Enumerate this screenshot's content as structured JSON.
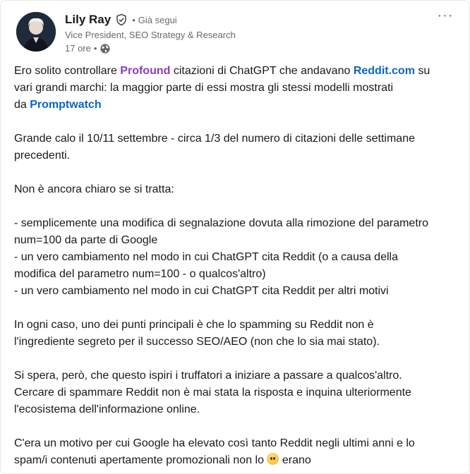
{
  "author": {
    "name": "Lily Ray",
    "follow_status": "Già segui",
    "headline": "Vice President, SEO Strategy & Research",
    "time_ago": "17 ore",
    "dot": "•",
    "dot2": "•"
  },
  "post": {
    "p1": {
      "a": "Ero solito controllare ",
      "brand1": "Profound",
      "b": " citazioni di ChatGPT che andavano ",
      "brand2": "Reddit.com",
      "c": " su",
      "line2": "vari grandi marchi: la maggior parte di essi mostra gli stessi modelli mostrati",
      "d": "da ",
      "brand3": "Promptwatch"
    },
    "p2_l1": "Grande calo il 10/11 settembre - circa 1/3 del numero di citazioni delle settimane",
    "p2_l2": "precedenti.",
    "p3": "Non è ancora chiaro se si tratta:",
    "b1_l1": "- semplicemente una modifica di segnalazione dovuta alla rimozione del parametro",
    "b1_l2": "num=100 da parte di Google",
    "b2_l1": "- un vero cambiamento nel modo in cui ChatGPT cita Reddit (o a causa della",
    "b2_l2": "modifica del parametro num=100 - o qualcos'altro)",
    "b3": "- un vero cambiamento nel modo in cui ChatGPT cita Reddit per altri motivi",
    "p4_l1": "In ogni caso, uno dei punti principali è che lo spamming su Reddit non è",
    "p4_l2": "l'ingrediente segreto per il successo SEO/AEO (non che lo sia mai stato).",
    "p5_l1": "Si spera, però, che questo ispiri i truffatori a iniziare a passare a qualcos'altro.",
    "p5_l2": "Cercare di spammare Reddit non è mai stata la risposta e inquina ulteriormente",
    "p5_l3": "l'ecosistema dell'informazione online.",
    "p6_l1": "C'era un motivo per cui Google ha elevato così tanto Reddit negli ultimi anni e lo",
    "p6_l2a": "spam/i contenuti apertamente promozionali non lo ",
    "p6_l2b": " erano"
  },
  "icons": {
    "verified": "verified-shield-icon",
    "globe": "globe-icon",
    "more": "more-horizontal-icon",
    "emoji": "sweat-smile-emoji-icon"
  },
  "colors": {
    "brand_purple": "#8b3dbd",
    "link_blue": "#0a66c2",
    "secondary_text": "#666666"
  }
}
